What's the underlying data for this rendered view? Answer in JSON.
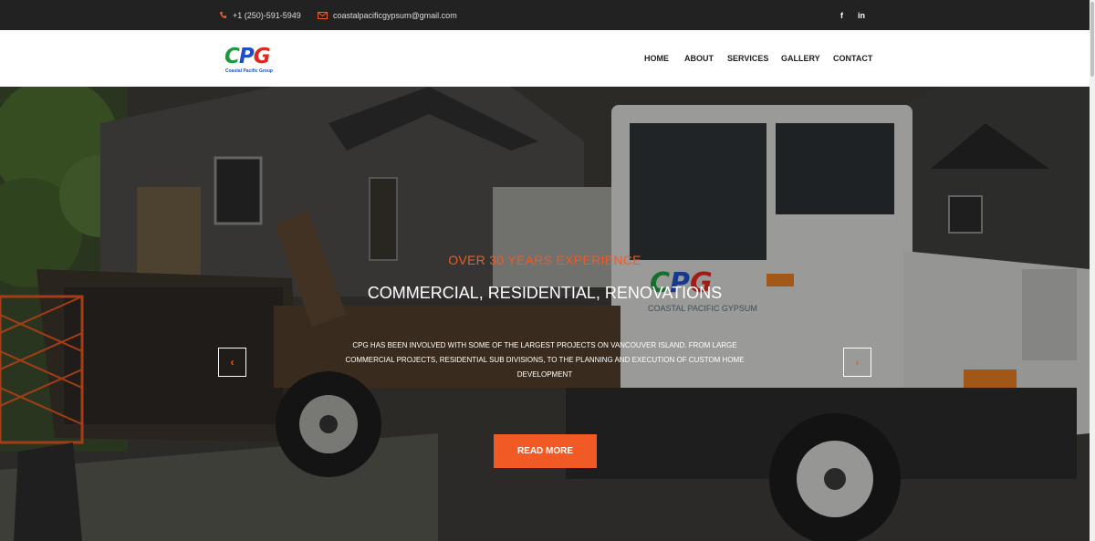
{
  "topbar": {
    "phone": "+1 (250)-591-5949",
    "email": "coastalpacificgypsum@gmail.com",
    "phone_icon": "phone-icon",
    "email_icon": "envelope-icon",
    "social": [
      {
        "icon": "facebook-icon",
        "glyph": "f"
      },
      {
        "icon": "linkedin-icon",
        "glyph": "in"
      }
    ]
  },
  "logo": {
    "c": "C",
    "p": "P",
    "g": "G",
    "tagline": "Coastal Pacific Group"
  },
  "nav": {
    "home": "HOME",
    "about": "ABOUT",
    "services": "SERVICES",
    "gallery": "GALLERY",
    "contact": "CONTACT"
  },
  "hero": {
    "kicker": "OVER 30 YEARS EXPERIENCE",
    "headline": "COMMERCIAL, RESIDENTIAL, RENOVATIONS",
    "body": "CPG HAS BEEN INVOLVED WITH SOME OF THE LARGEST PROJECTS ON VANCOUVER ISLAND. FROM LARGE COMMERCIAL PROJECTS, RESIDENTIAL SUB DIVISIONS, TO THE PLANNING AND EXECUTION OF CUSTOM HOME DEVELOPMENT",
    "cta": "READ MORE",
    "prev_glyph": "‹",
    "next_glyph": "›",
    "truck_logo": "CPG",
    "truck_text": "COASTAL PACIFIC GYPSUM"
  },
  "colors": {
    "accent": "#f15a24",
    "topbar_bg": "#222222",
    "logo_green": "#1c9a3c",
    "logo_blue": "#1f4fc8",
    "logo_red": "#e0281f"
  }
}
